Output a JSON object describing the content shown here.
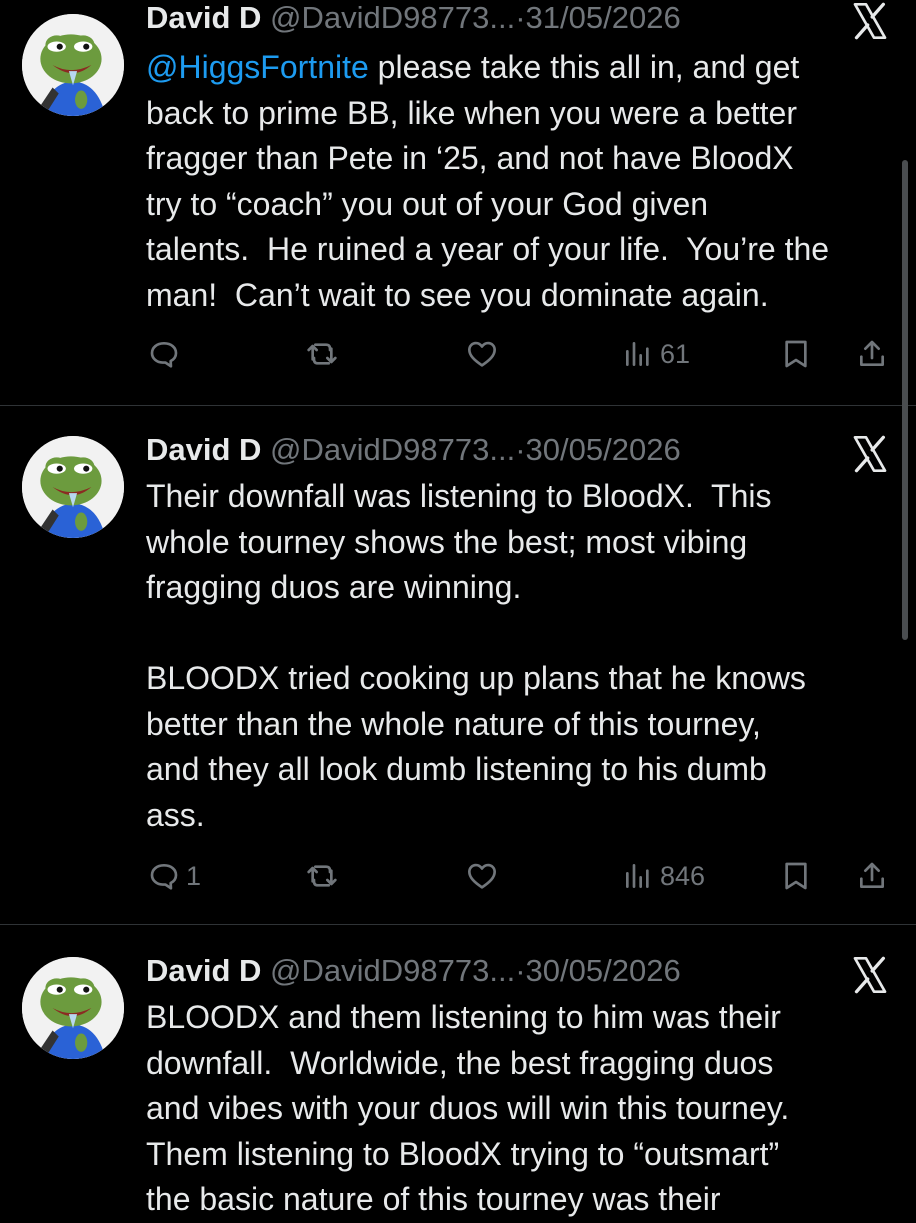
{
  "tweets": [
    {
      "name": "David D",
      "handle": "@DavidD98773...",
      "separator": "·",
      "date": "31/05/2026",
      "mention": "@HiggsFortnite",
      "text": " please take this all in, and get\nback to prime BB, like when you were a better\nfragger than Pete in ‘25, and not have BloodX\ntry to “coach” you out of your God given\ntalents.  He ruined a year of your life.  You’re the\nman!  Can’t wait to see you dominate again.",
      "replies": "",
      "views": "61"
    },
    {
      "name": "David D",
      "handle": "@DavidD98773...",
      "separator": "·",
      "date": "30/05/2026",
      "mention": "",
      "text": "Their downfall was listening to BloodX.  This\nwhole tourney shows the best; most vibing\nfragging duos are winning.\n\nBLOODX tried cooking up plans that he knows\nbetter than the whole nature of this tourney,\nand they all look dumb listening to his dumb\nass.",
      "replies": "1",
      "views": "846"
    },
    {
      "name": "David D",
      "handle": "@DavidD98773...",
      "separator": "·",
      "date": "30/05/2026",
      "mention": "",
      "text": "BLOODX and them listening to him was their\ndownfall.  Worldwide, the best fragging duos\nand vibes with your duos will win this tourney.\nThem listening to BloodX trying to “outsmart”\nthe basic nature of this tourney was their",
      "replies": "",
      "views": ""
    }
  ],
  "colors": {
    "background": "#000000",
    "text": "#e7e9ea",
    "muted": "#71767b",
    "link": "#1d9bf0",
    "divider": "#2f3336"
  },
  "icons": [
    "avatar-frog",
    "x-logo-icon",
    "reply-icon",
    "retweet-icon",
    "like-icon",
    "views-icon",
    "bookmark-icon",
    "share-icon"
  ]
}
